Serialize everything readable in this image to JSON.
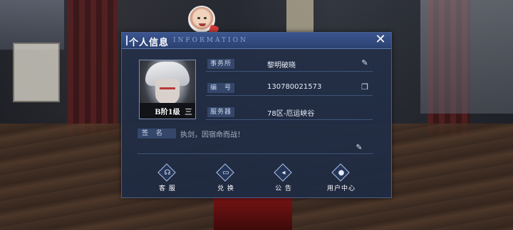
{
  "dialog": {
    "title_zh": "个人信息",
    "title_en": "INFORMATION",
    "close_glyph": "✕"
  },
  "profile": {
    "rank": "B阶1级",
    "rank_mark": "三",
    "fields": [
      {
        "label": "事务所",
        "value": "黎明破晓",
        "icon": "edit-icon",
        "icon_glyph": "✎"
      },
      {
        "label": "编　号",
        "value": "130780021573",
        "icon": "copy-icon",
        "icon_glyph": "❐"
      },
      {
        "label": "服务器",
        "value": "78区-厄运峡谷",
        "icon": "",
        "icon_glyph": ""
      }
    ],
    "signature_label": "签 名",
    "signature_text": "执剑，因宿命而战！",
    "signature_edit_glyph": "✎"
  },
  "actions": [
    {
      "label": "客 服",
      "icon": "headset-icon",
      "glyph": "☊"
    },
    {
      "label": "兑 换",
      "icon": "ticket-icon",
      "glyph": "▭"
    },
    {
      "label": "公 告",
      "icon": "megaphone-icon",
      "glyph": "◂"
    },
    {
      "label": "用户中心",
      "icon": "user-icon",
      "glyph": "●"
    }
  ],
  "colors": {
    "panel": "#22304a",
    "titlebar": "#2b4170",
    "label_bg": "#34476b"
  }
}
